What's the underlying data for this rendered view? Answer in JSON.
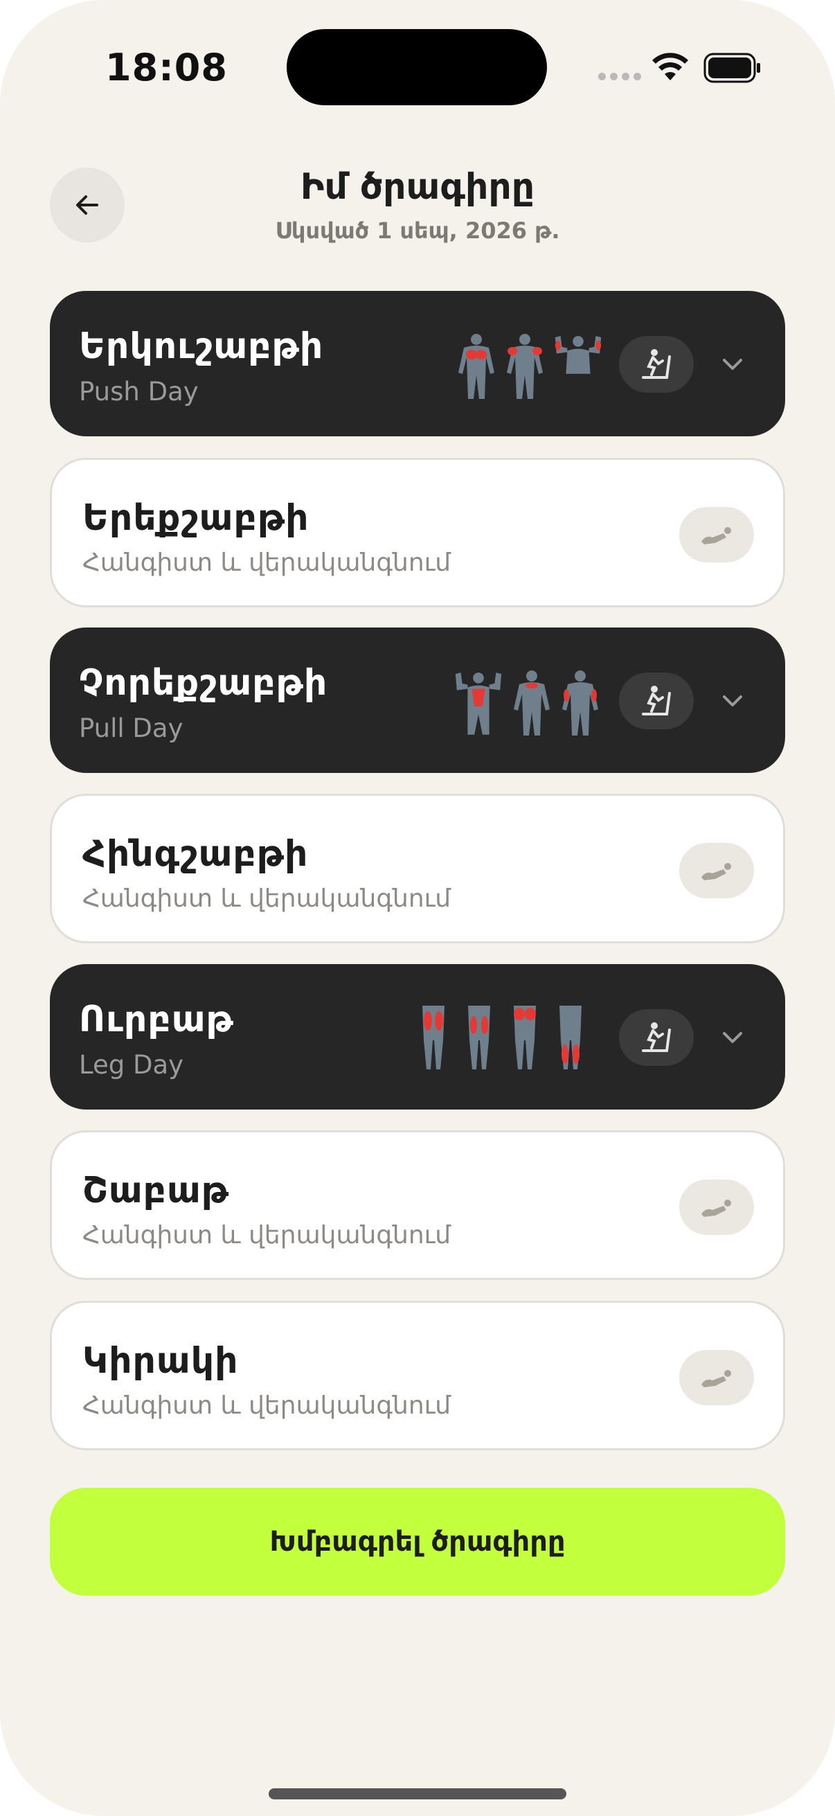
{
  "status_bar": {
    "time": "18:08"
  },
  "header": {
    "title": "Իմ ծրագիրը",
    "subtitle": "Սկսված 1 սեպ, 2026 թ."
  },
  "days": [
    {
      "day": "Երկուշաբթի",
      "sub": "Push Day",
      "type": "workout"
    },
    {
      "day": "Երեքշաբթի",
      "sub": "Հանգիստ և վերականգնում",
      "type": "rest"
    },
    {
      "day": "Չորեքշաբթի",
      "sub": "Pull Day",
      "type": "workout"
    },
    {
      "day": "Հինգշաբթի",
      "sub": "Հանգիստ և վերականգնում",
      "type": "rest"
    },
    {
      "day": "Ուրբաթ",
      "sub": "Leg Day",
      "type": "workout"
    },
    {
      "day": "Շաբաթ",
      "sub": "Հանգիստ և վերականգնում",
      "type": "rest"
    },
    {
      "day": "Կիրակի",
      "sub": "Հանգիստ և վերականգնում",
      "type": "rest"
    }
  ],
  "edit_button": {
    "label": "Խմբագրել ծրագիրը"
  },
  "colors": {
    "background": "#f5f2eb",
    "dark_card": "#262626",
    "accent": "#c2ff3d",
    "muscle_highlight": "#e53935",
    "body_gray": "#6f7f8c"
  },
  "icons": {
    "back": "arrow-left-icon",
    "cardio": "treadmill-icon",
    "rest": "lying-person-icon",
    "expand": "chevron-down-icon"
  }
}
